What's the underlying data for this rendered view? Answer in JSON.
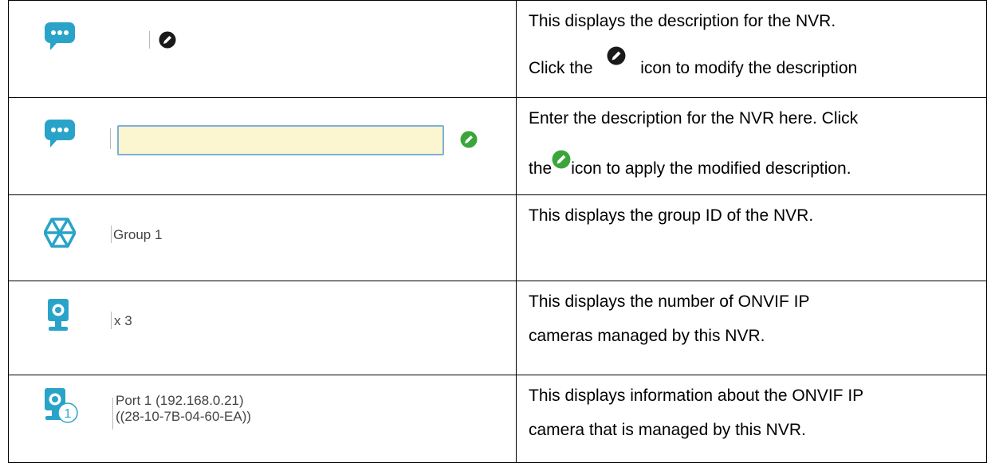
{
  "rows": [
    {
      "icon": "speech-bubble-icon",
      "ui": {
        "edit_icon": "pencil-black-icon"
      },
      "text": {
        "line1": "This displays the description for the NVR.",
        "line2_before": "Click the",
        "line2_icon": "pencil-black-icon",
        "line2_after": "icon to modify the description"
      }
    },
    {
      "icon": "speech-bubble-icon",
      "ui": {
        "field_value": "",
        "apply_icon": "pencil-green-icon"
      },
      "text": {
        "line1": "Enter the description for the NVR here. Click",
        "line2_before": "the",
        "line2_icon": "pencil-green-icon",
        "line2_after": "icon to apply the modified description."
      }
    },
    {
      "icon": "group-hexagon-icon",
      "ui": {
        "value": "Group 1"
      },
      "text": {
        "line1": "This displays the group ID of the NVR."
      }
    },
    {
      "icon": "ip-camera-icon",
      "ui": {
        "value": "x 3"
      },
      "text": {
        "line1": "This displays the number of ONVIF IP",
        "line2": "cameras managed by this NVR."
      }
    },
    {
      "icon": "ip-camera-port-icon",
      "ui": {
        "port_badge": "1",
        "line1": "Port 1 (192.168.0.21)",
        "line2": "((28-10-7B-04-60-EA))"
      },
      "text": {
        "line1": "This displays information about the ONVIF IP",
        "line2": "camera that is managed by this NVR."
      }
    }
  ],
  "colors": {
    "icon_blue": "#2aa3c9",
    "pencil_green": "#3aa53a",
    "field_bg": "#fbf6cf",
    "field_border": "#7fb0d6"
  }
}
